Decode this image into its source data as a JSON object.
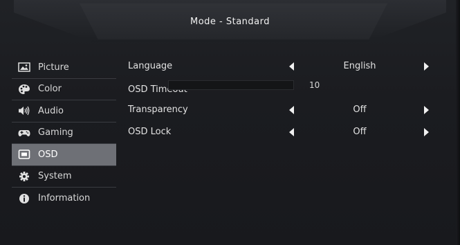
{
  "header": {
    "title": "Mode - Standard"
  },
  "sidebar": {
    "items": [
      {
        "label": "Picture",
        "icon": "picture-icon",
        "active": false
      },
      {
        "label": "Color",
        "icon": "palette-icon",
        "active": false
      },
      {
        "label": "Audio",
        "icon": "speaker-icon",
        "active": false
      },
      {
        "label": "Gaming",
        "icon": "gamepad-icon",
        "active": false
      },
      {
        "label": "OSD",
        "icon": "osd-icon",
        "active": true
      },
      {
        "label": "System",
        "icon": "gear-icon",
        "active": false
      },
      {
        "label": "Information",
        "icon": "info-icon",
        "active": false
      }
    ]
  },
  "settings": {
    "language": {
      "label": "Language",
      "value": "English"
    },
    "osd_timeout": {
      "label": "OSD Timeout",
      "value": "10",
      "level": 0
    },
    "transparency": {
      "label": "Transparency",
      "value": "Off"
    },
    "osd_lock": {
      "label": "OSD Lock",
      "value": "Off"
    }
  },
  "colors": {
    "active_item_bg": "#6e7076",
    "text": "#e2e2e2",
    "background": "#1b1c20"
  }
}
